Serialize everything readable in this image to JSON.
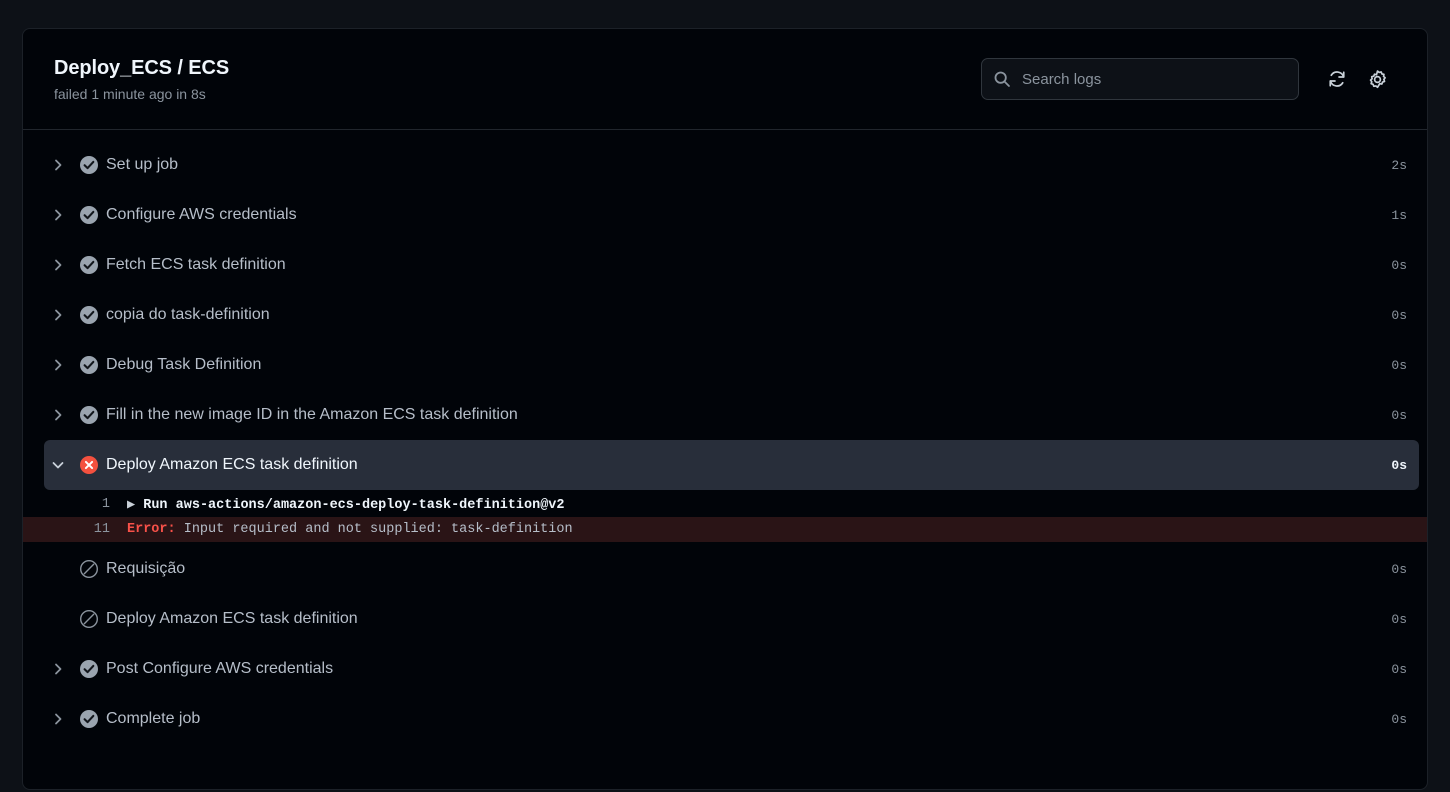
{
  "header": {
    "title": "Deploy_ECS / ECS",
    "status": "failed 1 minute ago in 8s",
    "search_placeholder": "Search logs",
    "search_value": "",
    "search_icon": "search-icon",
    "refresh_icon": "refresh-icon",
    "settings_icon": "gear-icon"
  },
  "steps": [
    {
      "name": "Set up job",
      "duration": "2s",
      "state": "success",
      "expandable": true,
      "expanded": false
    },
    {
      "name": "Configure AWS credentials",
      "duration": "1s",
      "state": "success",
      "expandable": true,
      "expanded": false
    },
    {
      "name": "Fetch ECS task definition",
      "duration": "0s",
      "state": "success",
      "expandable": true,
      "expanded": false
    },
    {
      "name": "copia do task-definition",
      "duration": "0s",
      "state": "success",
      "expandable": true,
      "expanded": false
    },
    {
      "name": "Debug Task Definition",
      "duration": "0s",
      "state": "success",
      "expandable": true,
      "expanded": false
    },
    {
      "name": "Fill in the new image ID in the Amazon ECS task definition",
      "duration": "0s",
      "state": "success",
      "expandable": true,
      "expanded": false
    },
    {
      "name": "Deploy Amazon ECS task definition",
      "duration": "0s",
      "state": "failure",
      "expandable": true,
      "expanded": true
    },
    {
      "name": "Requisição",
      "duration": "0s",
      "state": "skipped",
      "expandable": false,
      "expanded": false
    },
    {
      "name": "Deploy Amazon ECS task definition",
      "duration": "0s",
      "state": "skipped",
      "expandable": false,
      "expanded": false
    },
    {
      "name": "Post Configure AWS credentials",
      "duration": "0s",
      "state": "success",
      "expandable": true,
      "expanded": false
    },
    {
      "name": "Complete job",
      "duration": "0s",
      "state": "success",
      "expandable": true,
      "expanded": false
    }
  ],
  "log": {
    "lines": [
      {
        "number": "1",
        "type": "run",
        "marker": "▶ ",
        "keyword": "Run ",
        "rest": "aws-actions/amazon-ecs-deploy-task-definition@v2"
      },
      {
        "number": "11",
        "type": "error",
        "label": "Error: ",
        "message": "Input required and not supplied: task-definition"
      }
    ]
  },
  "colors": {
    "page_bg": "#0d1117",
    "card_bg": "#010409",
    "row_highlight": "#282e3a",
    "error_bg": "#2a1416",
    "error_red": "#f85149",
    "success_grey": "#8b949e",
    "text_primary": "#f0f6fc",
    "text_secondary": "#8b949e"
  }
}
